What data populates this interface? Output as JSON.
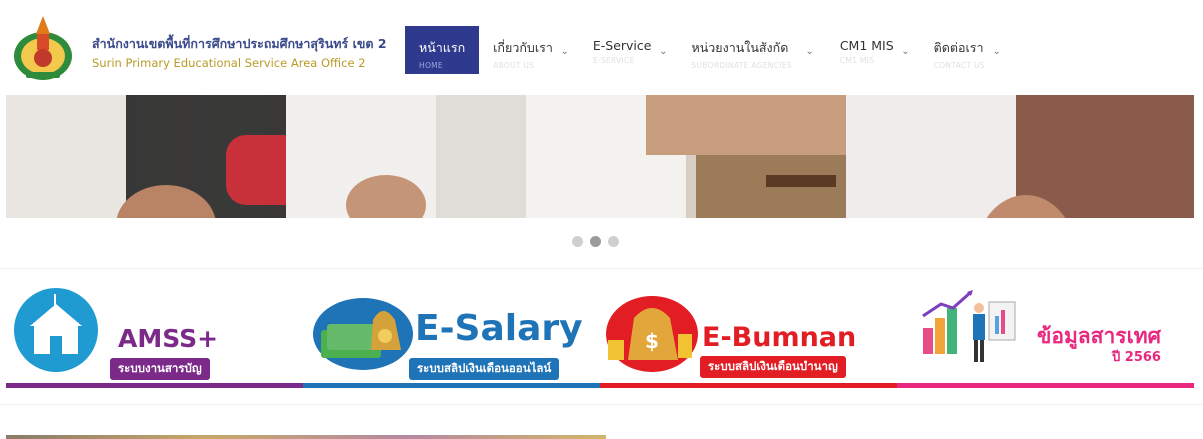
{
  "header": {
    "brand_th": "สำนักงานเขตพื้นที่การศึกษาประถมศึกษาสุรินทร์ เขต 2",
    "brand_en": "Surin Primary Educational Service Area Office 2",
    "logo_icon": "school-crest-icon"
  },
  "nav": {
    "items": [
      {
        "label": "หน้าแรก",
        "sub": "HOME",
        "active": true
      },
      {
        "label": "เกี่ยวกับเรา",
        "sub": "ABOUT US"
      },
      {
        "label": "E-Service",
        "sub": "E-SERVICE"
      },
      {
        "label": "หน่วยงานในสังกัด",
        "sub": "SUBORDINATE AGENCIES"
      },
      {
        "label": "CM1 MIS",
        "sub": "CM1 MIS"
      },
      {
        "label": "ติดต่อเรา",
        "sub": "CONTACT US"
      }
    ],
    "active_color": "#2f3a8e"
  },
  "slider": {
    "slide_count": 3,
    "active_index": 1
  },
  "services": [
    {
      "title": "AMSS+",
      "sub": "ระบบงานสารบัญ",
      "color": "#7c2a8a",
      "icon": "school-building-icon"
    },
    {
      "title": "E-Salary",
      "sub": "ระบบสลิปเงินเดือนออนไลน์",
      "color": "#1f73b7",
      "icon": "money-bag-icon"
    },
    {
      "title": "E-Bumnan",
      "sub": "ระบบสลิปเงินเดือนบำนาญ",
      "color": "#e21d24",
      "icon": "coin-bag-icon"
    },
    {
      "title": "ข้อมูลสารเทศ",
      "sub": "ปี 2566",
      "color": "#e8287f",
      "icon": "bar-chart-presenter-icon"
    }
  ]
}
